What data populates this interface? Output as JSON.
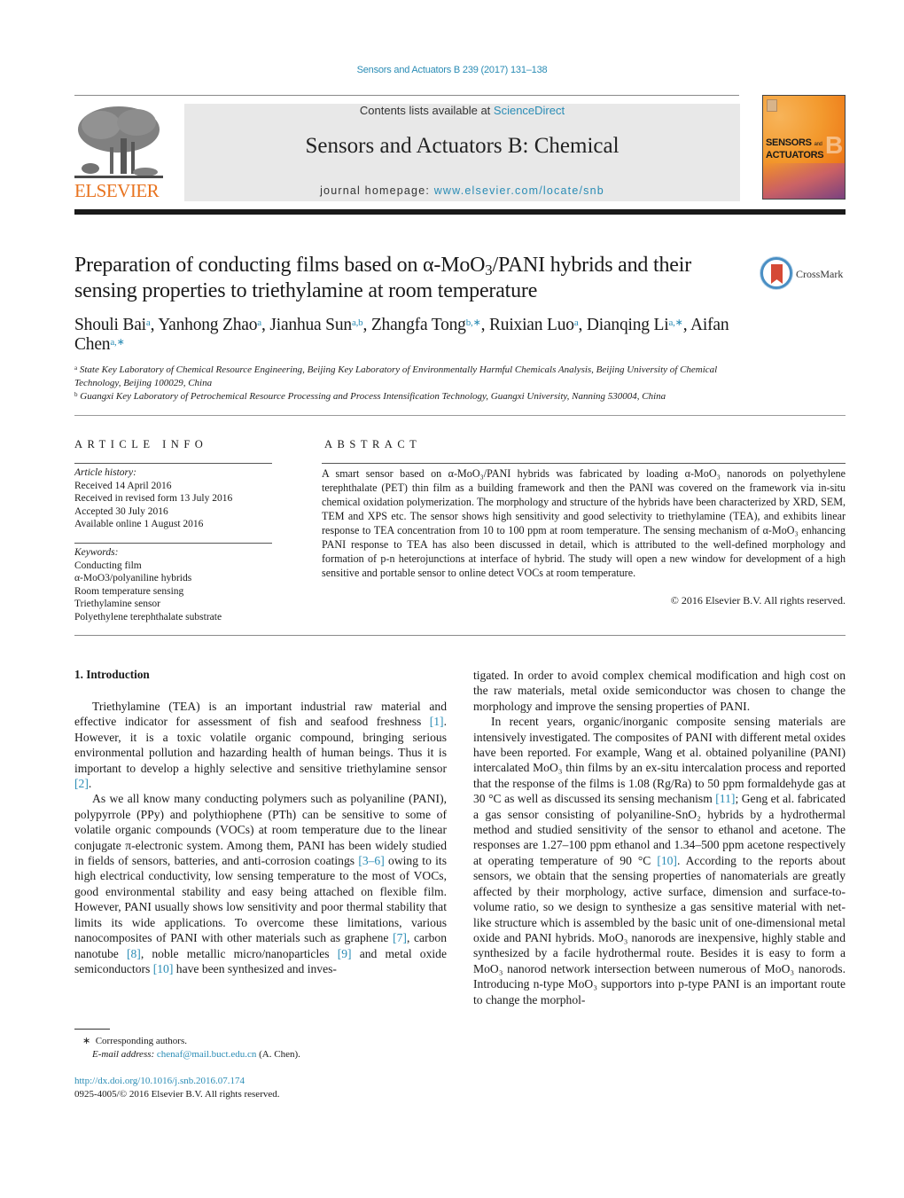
{
  "header": {
    "citation": "Sensors and Actuators B 239 (2017) 131–138",
    "contents_prefix": "Contents lists available at ",
    "contents_link": "ScienceDirect",
    "journal_title": "Sensors and Actuators B: Chemical",
    "homepage_prefix": "journal homepage: ",
    "homepage_link": "www.elsevier.com/locate/snb",
    "publisher_logo": "ELSEVIER",
    "cover": {
      "title_line1": "SENSORS",
      "title_small": "and",
      "title_line2": "ACTUATORS",
      "letter": "B"
    },
    "crossmark_label": "CrossMark"
  },
  "colors": {
    "link": "#2a8cb5",
    "elsevier_orange": "#e8731f",
    "masthead_bg": "#e8e8e8"
  },
  "article": {
    "title_part1": "Preparation of conducting films based on α-MoO",
    "title_sub": "3",
    "title_part2": "/PANI hybrids and their sensing properties to triethylamine at room temperature",
    "authors": [
      {
        "name": "Shouli Bai",
        "aff": "a",
        "sep": ", "
      },
      {
        "name": "Yanhong Zhao",
        "aff": "a",
        "sep": ", "
      },
      {
        "name": "Jianhua Sun",
        "aff": "a,b",
        "sep": ", "
      },
      {
        "name": "Zhangfa Tong",
        "aff": "b,∗",
        "sep": ", "
      },
      {
        "name": "Ruixian Luo",
        "aff": "a",
        "sep": ", "
      },
      {
        "name": "Dianqing Li",
        "aff": "a,∗",
        "sep": ", "
      },
      {
        "name": "Aifan Chen",
        "aff": "a,∗",
        "sep": ""
      }
    ],
    "affiliations": [
      {
        "mark": "a",
        "text": "State Key Laboratory of Chemical Resource Engineering, Beijing Key Laboratory of Environmentally Harmful Chemicals Analysis, Beijing University of Chemical Technology, Beijing 100029, China"
      },
      {
        "mark": "b",
        "text": "Guangxi Key Laboratory of Petrochemical Resource Processing and Process Intensification Technology, Guangxi University, Nanning 530004, China"
      }
    ]
  },
  "article_info": {
    "heading": "ARTICLE INFO",
    "history_label": "Article history:",
    "history": [
      "Received 14 April 2016",
      "Received in revised form 13 July 2016",
      "Accepted 30 July 2016",
      "Available online 1 August 2016"
    ],
    "keywords_label": "Keywords:",
    "keywords": [
      "Conducting film",
      "α-MoO3/polyaniline hybrids",
      "Room temperature sensing",
      "Triethylamine sensor",
      "Polyethylene terephthalate substrate"
    ]
  },
  "abstract": {
    "heading": "ABSTRACT",
    "text": "A smart sensor based on α-MoO₃/PANI hybrids was fabricated by loading α-MoO₃ nanorods on polyethylene terephthalate (PET) thin film as a building framework and then the PANI was covered on the framework via in-situ chemical oxidation polymerization. The morphology and structure of the hybrids have been characterized by XRD, SEM, TEM and XPS etc. The sensor shows high sensitivity and good selectivity to triethylamine (TEA), and exhibits linear response to TEA concentration from 10 to 100 ppm at room temperature. The sensing mechanism of α-MoO₃ enhancing PANI response to TEA has also been discussed in detail, which is attributed to the well-defined morphology and formation of p-n heterojunctions at interface of hybrid. The study will open a new window for development of a high sensitive and portable sensor to online detect VOCs at room temperature.",
    "copyright": "© 2016 Elsevier B.V. All rights reserved."
  },
  "introduction": {
    "heading": "1.  Introduction",
    "paragraphs": [
      {
        "segments": [
          {
            "t": "Triethylamine (TEA) is an important industrial raw material and effective indicator for assessment of fish and seafood freshness "
          },
          {
            "t": "[1]",
            "ref": true
          },
          {
            "t": ". However, it is a toxic volatile organic compound, bringing serious environmental pollution and hazarding health of human beings. Thus it is important to develop a highly selective and sensitive triethylamine sensor "
          },
          {
            "t": "[2]",
            "ref": true
          },
          {
            "t": "."
          }
        ]
      },
      {
        "segments": [
          {
            "t": "As we all know many conducting polymers such as polyaniline (PANI), polypyrrole (PPy) and polythiophene (PTh) can be sensitive to some of volatile organic compounds (VOCs) at room temperature due to the linear conjugate π-electronic system. Among them, PANI has been widely studied in fields of sensors, batteries, and anti-corrosion coatings "
          },
          {
            "t": "[3–6]",
            "ref": true
          },
          {
            "t": " owing to its high electrical conductivity, low sensing temperature to the most of VOCs, good environmental stability and easy being attached on flexible film. However, PANI usually shows low sensitivity and poor thermal stability that limits its wide applications. To overcome these limitations, various nanocomposites of PANI with other materials such as graphene "
          },
          {
            "t": "[7]",
            "ref": true
          },
          {
            "t": ", carbon nanotube "
          },
          {
            "t": "[8]",
            "ref": true
          },
          {
            "t": ", noble metallic micro/nanoparticles "
          },
          {
            "t": "[9]",
            "ref": true
          },
          {
            "t": " and metal oxide semiconductors "
          },
          {
            "t": "[10]",
            "ref": true
          },
          {
            "t": " have been synthesized and investigated. In order to avoid complex chemical modification and high cost on the raw materials, metal oxide semiconductor was chosen to change the morphology and improve the sensing properties of PANI."
          }
        ]
      },
      {
        "segments": [
          {
            "t": "In recent years, organic/inorganic composite sensing materials are intensively investigated. The composites of PANI with different metal oxides have been reported. For example, Wang et al. obtained polyaniline (PANI) intercalated MoO₃ thin films by an ex-situ intercalation process and reported that the response of the films is 1.08 (Rg/Ra) to 50 ppm formaldehyde gas at 30 °C as well as discussed its sensing mechanism "
          },
          {
            "t": "[11]",
            "ref": true
          },
          {
            "t": "; Geng et al. fabricated a gas sensor consisting of polyaniline-SnO₂ hybrids by a hydrothermal method and studied sensitivity of the sensor to ethanol and acetone. The responses are 1.27–100 ppm ethanol and 1.34–500 ppm acetone respectively at operating temperature of 90 °C "
          },
          {
            "t": "[10]",
            "ref": true
          },
          {
            "t": ". According to the reports about sensors, we obtain that the sensing properties of nanomaterials are greatly affected by their morphology, active surface, dimension and surface-to-volume ratio, so we design to synthesize a gas sensitive material with net-like structure which is assembled by the basic unit of one-dimensional metal oxide and PANI hybrids. MoO₃ nanorods are inexpensive, highly stable and synthesized by a facile hydrothermal route. Besides it is easy to form a MoO₃ nanorod network intersection between numerous of MoO₃ nanorods. Introducing n-type MoO₃ supportors into p-type PANI is an important route to change the morphol-"
          }
        ]
      }
    ]
  },
  "footnote": {
    "mark": "∗",
    "corresponding": "Corresponding authors.",
    "email_label": "E-mail address:",
    "email": "chenaf@mail.buct.edu.cn",
    "email_owner": " (A. Chen)."
  },
  "doi": {
    "link": "http://dx.doi.org/10.1016/j.snb.2016.07.174",
    "issn_line": "0925-4005/© 2016 Elsevier B.V. All rights reserved."
  }
}
